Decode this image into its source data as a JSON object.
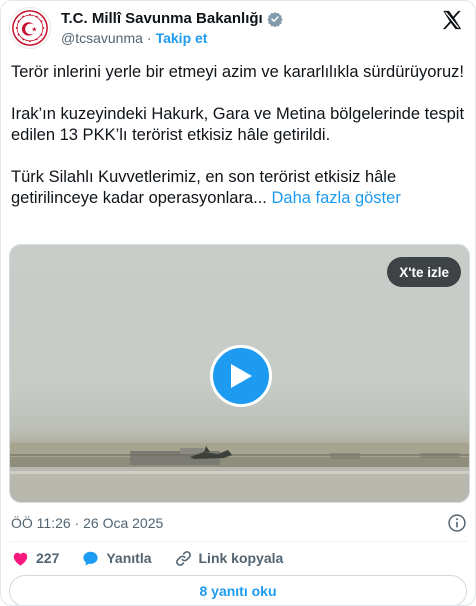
{
  "header": {
    "display_name": "T.C. Millî Savunma Bakanlığı",
    "handle": "@tcsavunma",
    "separator": "·",
    "follow_label": "Takip et",
    "verified_color": "#829aab"
  },
  "tweet": {
    "paragraphs": [
      "Terör inlerini yerle bir etmeyi azim ve kararlılıkla sürdürüyoruz!",
      "Irak’ın kuzeyindeki Hakurk, Gara ve Metina bölgelerinde tespit edilen 13 PKK’lı terörist etkisiz hâle getirildi.",
      "Türk Silahlı Kuvvetlerimiz, en son terörist etkisiz hâle getirilinceye kadar operasyonlara..."
    ],
    "show_more_label": "Daha fazla göster"
  },
  "video": {
    "watch_on_x_label": "X'te izle"
  },
  "meta": {
    "timestamp": "ÖÖ 11:26 · 26 Oca 2025"
  },
  "actions": {
    "like_count": "227",
    "reply_label": "Yanıtla",
    "copy_link_label": "Link kopyala"
  },
  "replies_button_label": "8 yanıtı oku",
  "colors": {
    "accent": "#1d9bf0",
    "like": "#f91880",
    "text": "#0f1419",
    "muted": "#536471"
  },
  "icons": [
    "verified-badge-icon",
    "x-logo-icon",
    "play-icon",
    "info-icon",
    "heart-icon",
    "reply-bubble-icon",
    "link-icon"
  ]
}
